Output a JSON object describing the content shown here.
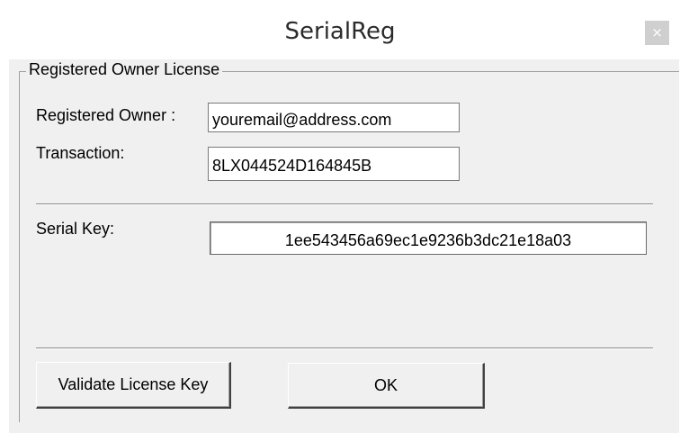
{
  "window": {
    "title": "SerialReg",
    "close_glyph": "×"
  },
  "group": {
    "legend": "Registered Owner License"
  },
  "form": {
    "owner_label": "Registered Owner :",
    "owner_value": "youremail@address.com",
    "transaction_label": "Transaction:",
    "transaction_value": "8LX044524D164845B",
    "serial_label": "Serial Key:",
    "serial_value": "1ee543456a69ec1e9236b3dc21e18a03"
  },
  "buttons": {
    "validate_label": "Validate License Key",
    "ok_label": "OK"
  }
}
